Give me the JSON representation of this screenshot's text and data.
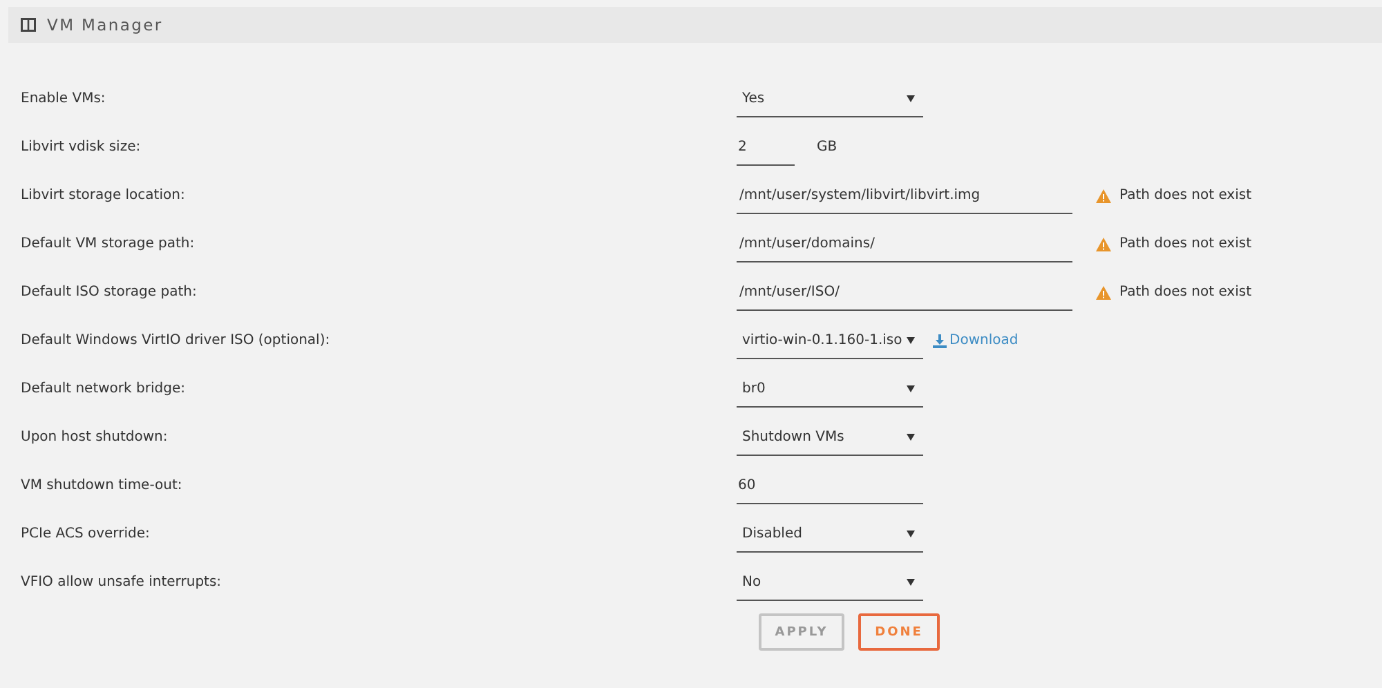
{
  "header": {
    "title": "VM Manager"
  },
  "settings": [
    {
      "label": "Enable VMs:",
      "kind": "select",
      "value": "Yes"
    },
    {
      "label": "Libvirt vdisk size:",
      "kind": "number",
      "value": "2",
      "unit": "GB"
    },
    {
      "label": "Libvirt storage location:",
      "kind": "path",
      "value": "/mnt/user/system/libvirt/libvirt.img",
      "warning": "Path does not exist"
    },
    {
      "label": "Default VM storage path:",
      "kind": "path",
      "value": "/mnt/user/domains/",
      "warning": "Path does not exist"
    },
    {
      "label": "Default ISO storage path:",
      "kind": "path",
      "value": "/mnt/user/ISO/",
      "warning": "Path does not exist"
    },
    {
      "label": "Default Windows VirtIO driver ISO (optional):",
      "kind": "select",
      "value": "virtio-win-0.1.160-1.iso",
      "link": "Download"
    },
    {
      "label": "Default network bridge:",
      "kind": "select",
      "value": "br0"
    },
    {
      "label": "Upon host shutdown:",
      "kind": "select",
      "value": "Shutdown VMs"
    },
    {
      "label": "VM shutdown time-out:",
      "kind": "text",
      "value": "60"
    },
    {
      "label": "PCIe ACS override:",
      "kind": "select",
      "value": "Disabled"
    },
    {
      "label": "VFIO allow unsafe interrupts:",
      "kind": "select",
      "value": "No"
    }
  ],
  "buttons": [
    {
      "label": "APPLY",
      "disabled": true
    },
    {
      "label": "DONE",
      "disabled": false
    }
  ]
}
